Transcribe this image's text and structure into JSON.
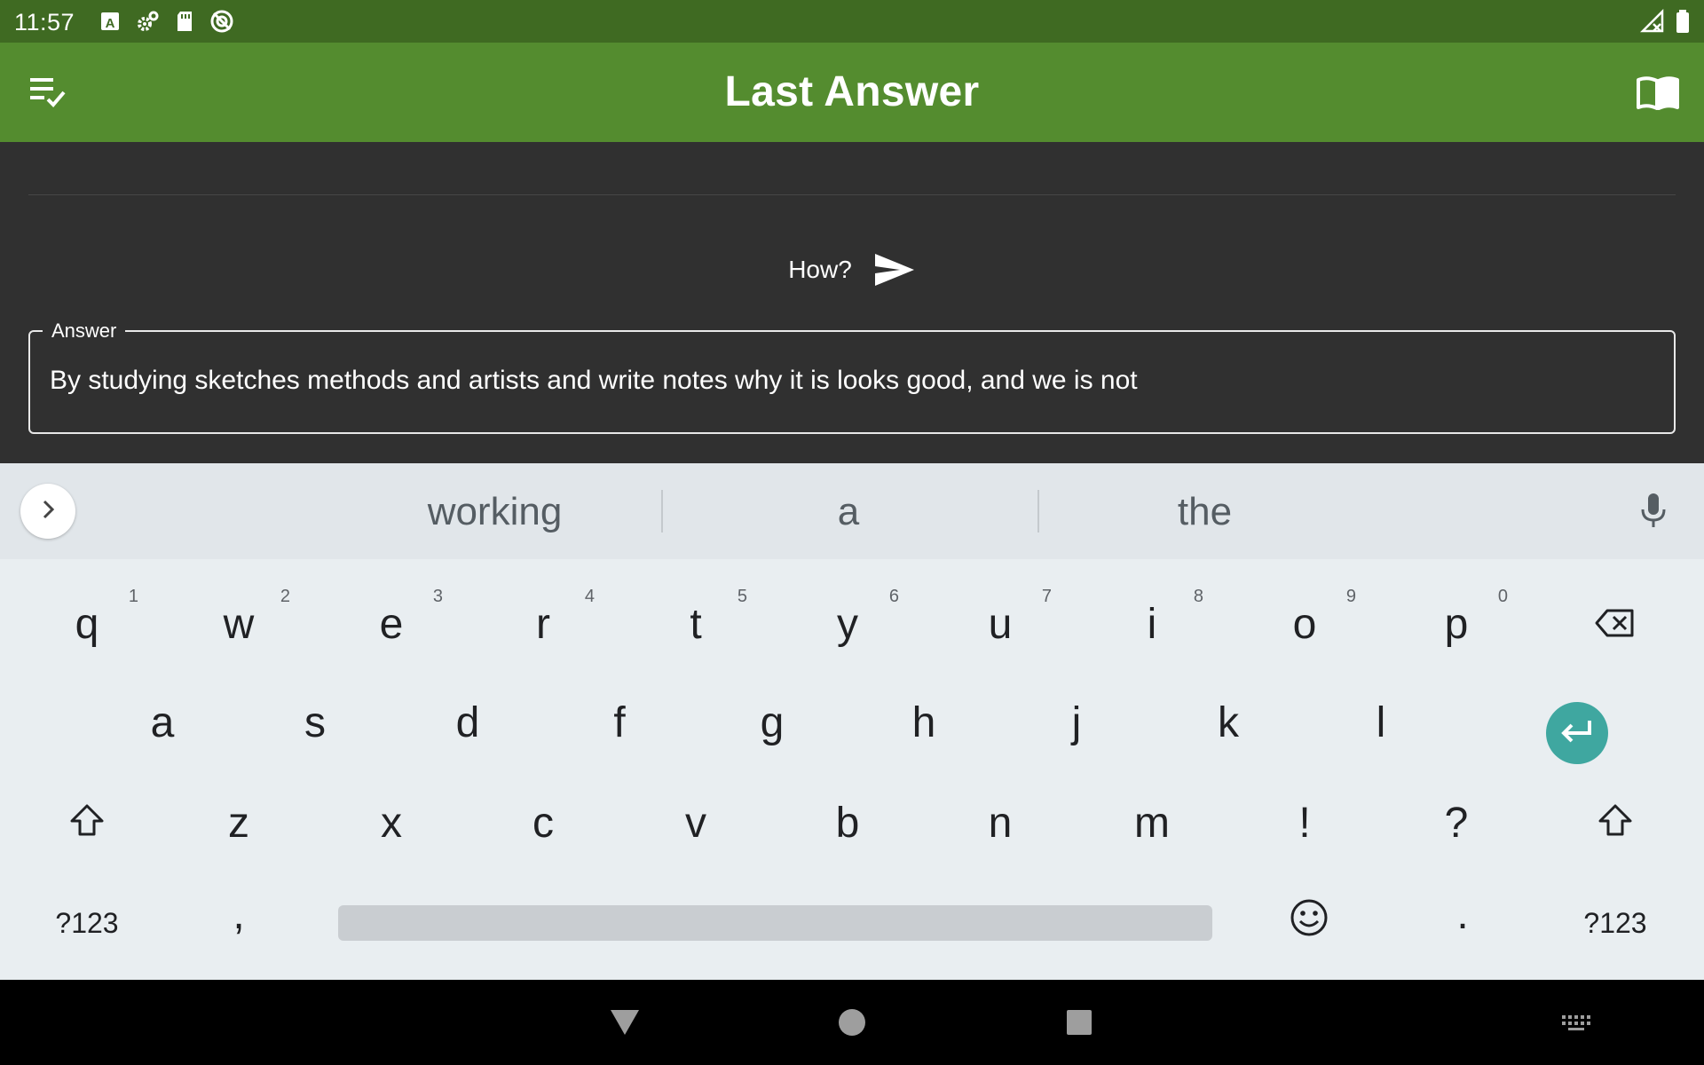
{
  "status_bar": {
    "time": "11:57",
    "icons": [
      "keyboard-a-icon",
      "settings-sync-icon",
      "sd-card-icon",
      "no-sync-icon"
    ],
    "right_icons": [
      "signal-off-icon",
      "battery-icon"
    ]
  },
  "app_bar": {
    "title": "Last Answer",
    "left_icon": "checklist-icon",
    "right_icon": "book-icon",
    "color": "#548c2f"
  },
  "content": {
    "question": "How?",
    "send_icon": "send-icon",
    "answer": {
      "label": "Answer",
      "value": "By studying sketches methods and artists and write notes why it is looks good, and we is not"
    }
  },
  "keyboard": {
    "suggestions": [
      "working",
      "a",
      "the"
    ],
    "row1": [
      {
        "k": "q",
        "h": "1"
      },
      {
        "k": "w",
        "h": "2"
      },
      {
        "k": "e",
        "h": "3"
      },
      {
        "k": "r",
        "h": "4"
      },
      {
        "k": "t",
        "h": "5"
      },
      {
        "k": "y",
        "h": "6"
      },
      {
        "k": "u",
        "h": "7"
      },
      {
        "k": "i",
        "h": "8"
      },
      {
        "k": "o",
        "h": "9"
      },
      {
        "k": "p",
        "h": "0"
      }
    ],
    "row2": [
      "a",
      "s",
      "d",
      "f",
      "g",
      "h",
      "j",
      "k",
      "l"
    ],
    "row3": [
      "z",
      "x",
      "c",
      "v",
      "b",
      "n",
      "m",
      "!",
      "?"
    ],
    "symbols_label": "?123",
    "comma": ",",
    "period": ".",
    "enter_color": "#3fa7a0"
  },
  "nav_bar": {
    "buttons": [
      "back-icon",
      "home-icon",
      "recents-icon",
      "keyboard-switch-icon"
    ]
  }
}
